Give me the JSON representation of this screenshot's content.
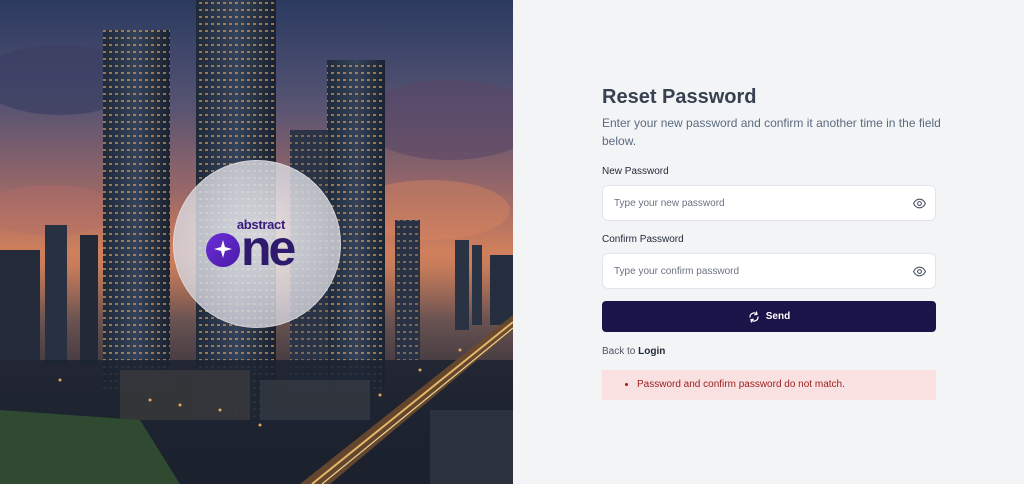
{
  "brand": {
    "logo_small": "abstract",
    "logo_big": "ne"
  },
  "form": {
    "title": "Reset Password",
    "subtitle": "Enter your new password and confirm it another time in the field below.",
    "new_password": {
      "label": "New Password",
      "placeholder": "Type your new password",
      "value": ""
    },
    "confirm_password": {
      "label": "Confirm Password",
      "placeholder": "Type your confirm password",
      "value": ""
    },
    "submit_label": "Send",
    "back_prefix": "Back to",
    "back_link": "Login",
    "errors": [
      "Password and confirm password do not match."
    ]
  },
  "colors": {
    "primary": "#1b1448",
    "page_bg": "#f3f4f6",
    "error_bg": "#f9e1e1",
    "error_text": "#9b1c1c",
    "brand_purple": "#2e1b6e"
  },
  "icons": {
    "password_toggle": "eye-icon",
    "send": "refresh-icon",
    "logo_spark": "sparkle-icon"
  }
}
